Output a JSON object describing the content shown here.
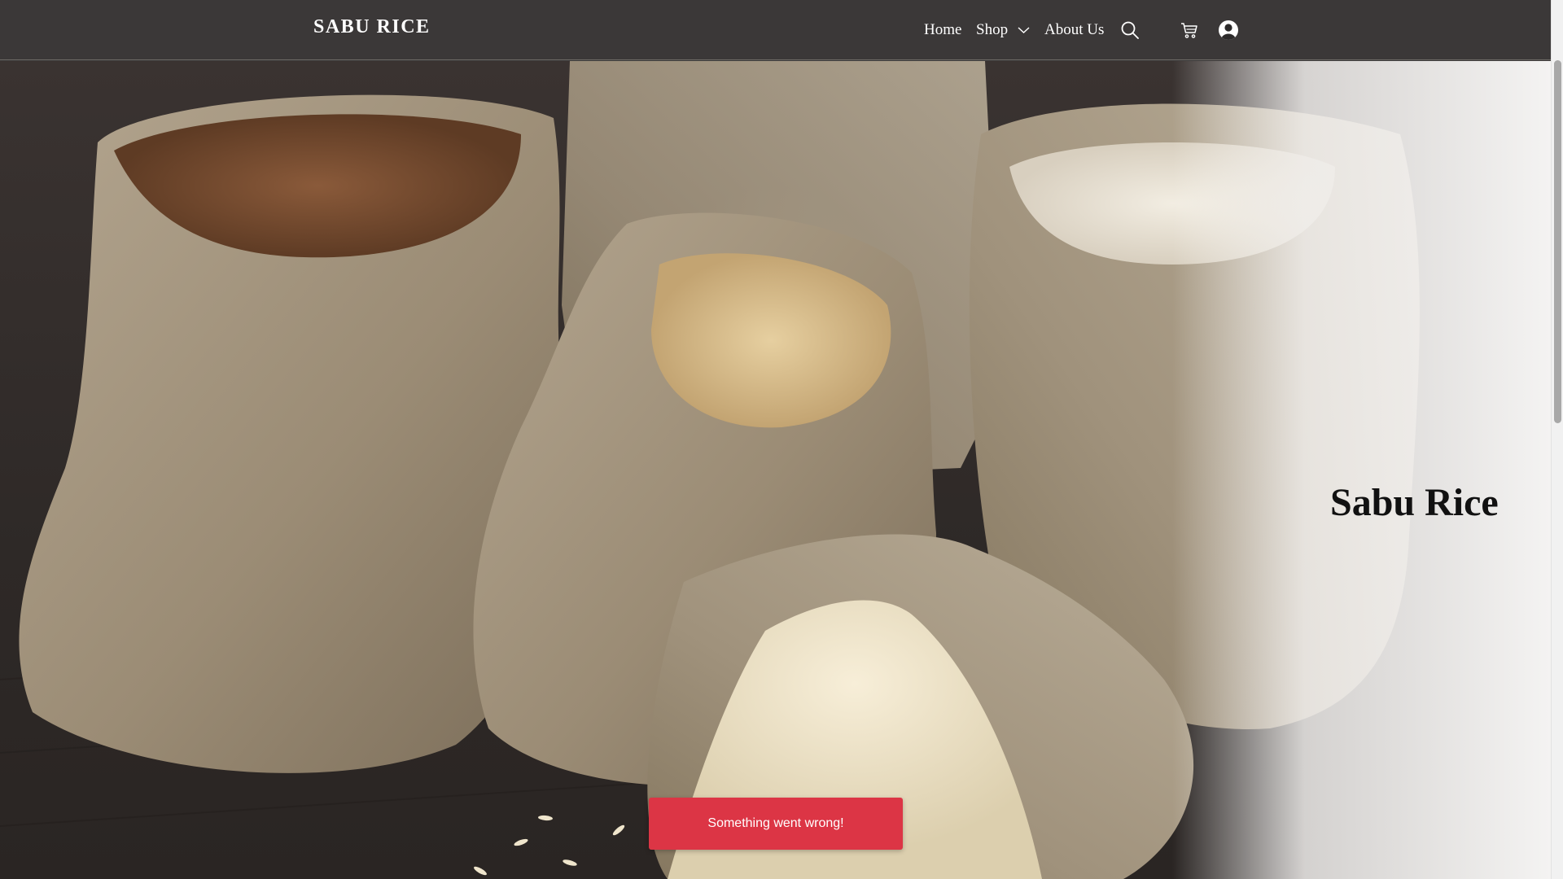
{
  "header": {
    "brand": "SABU RICE",
    "nav": {
      "home": "Home",
      "shop": "Shop",
      "about": "About Us"
    },
    "icons": {
      "search": "search-icon",
      "cart": "cart-icon",
      "account": "account-icon",
      "shop_dropdown": "chevron-down-icon"
    }
  },
  "hero": {
    "title": "Sabu Rice"
  },
  "toast": {
    "message": "Something went wrong!"
  },
  "colors": {
    "header_bg": "#3b3838",
    "toast_bg": "#dc3545",
    "text_light": "#ffffff",
    "hero_title": "#111111"
  }
}
